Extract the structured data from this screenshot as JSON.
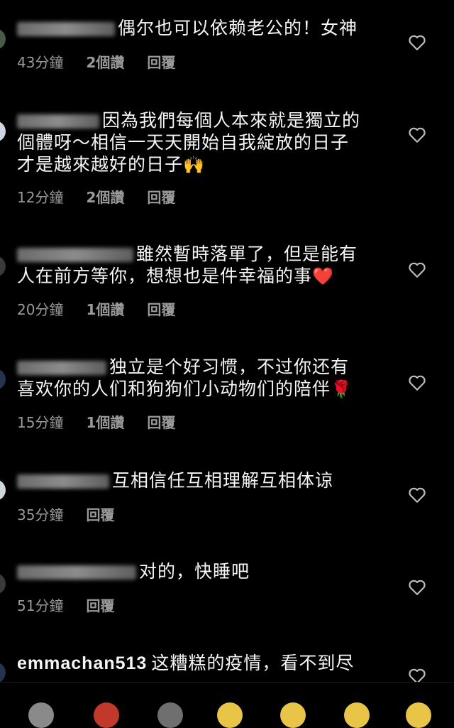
{
  "comments": [
    {
      "username": "",
      "text": "偶尔也可以依赖老公的！女神",
      "time": "43分鐘",
      "likes": "2個讚",
      "reply": "回覆"
    },
    {
      "username": "",
      "text_line1": "因為我們每個人本來就是獨立的",
      "text_line2": "個體呀～相信一天天開始自我綻放的日子",
      "text_line3": "才是越來越好的日子",
      "emoji": "🙌",
      "time": "12分鐘",
      "likes": "2個讚",
      "reply": "回覆"
    },
    {
      "username": "",
      "text_line1": "雖然暫時落單了，但是能有",
      "text_line2": "人在前方等你，想想也是件幸福的事",
      "emoji": "❤️",
      "time": "20分鐘",
      "likes": "1個讚",
      "reply": "回覆"
    },
    {
      "username": "",
      "text_line1": "独立是个好习惯，不过你还有",
      "text_line2": "喜欢你的人们和狗狗们小动物们的陪伴",
      "emoji": "🌹",
      "time": "15分鐘",
      "likes": "1個讚",
      "reply": "回覆"
    },
    {
      "username": "",
      "text": "互相信任互相理解互相体谅",
      "time": "35分鐘",
      "reply": "回覆"
    },
    {
      "username": "",
      "text": "对的，快睡吧",
      "time": "51分鐘",
      "reply": "回覆"
    },
    {
      "username": "emmachan513",
      "text": "这糟糕的疫情，看不到尽"
    }
  ],
  "icons": {
    "like": "heart-outline-icon",
    "avatar": "avatar-icon"
  },
  "colors": {
    "background": "#000000",
    "text": "#f5f5f5",
    "meta": "#9a9a9a"
  }
}
